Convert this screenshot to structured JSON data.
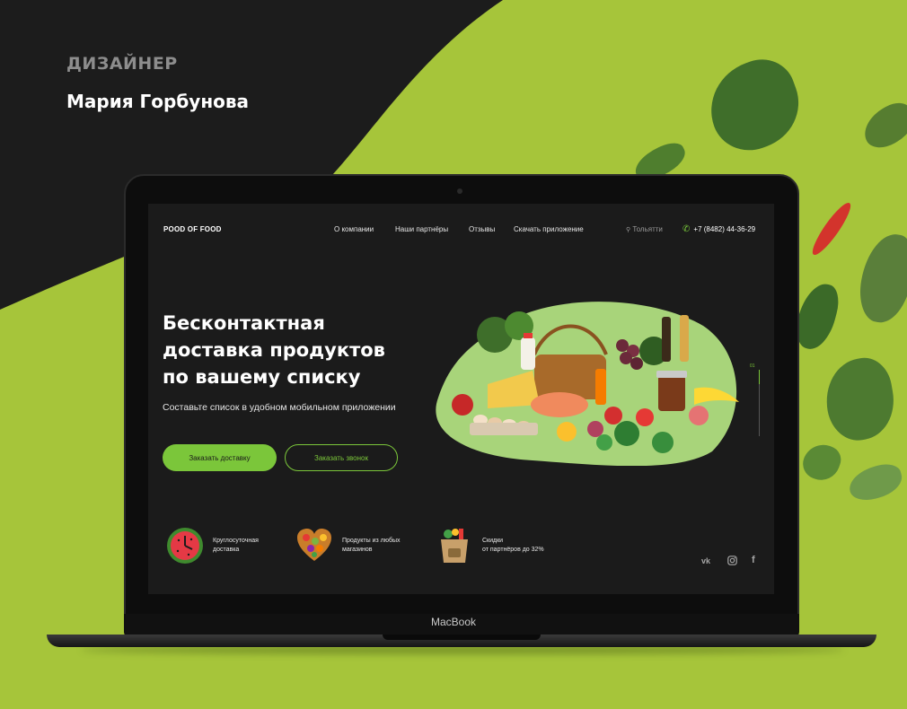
{
  "designer": {
    "label": "ДИЗАЙНЕР",
    "name": "Мария Горбунова"
  },
  "laptop_brand": "MacBook",
  "site": {
    "logo": "POOD OF FOOD",
    "nav": [
      "О компании",
      "Наши партнёры",
      "Отзывы",
      "Скачать приложение"
    ],
    "city": "Тольятти",
    "phone": "+7 (8482) 44-36-29",
    "hero_lines": [
      "Бесконтактная",
      "доставка продуктов",
      "по вашему списку"
    ],
    "subtitle": "Составьте список в удобном мобильном приложении",
    "primary_button": "Заказать доставку",
    "secondary_button": "Заказать звонок",
    "slider_number": "01",
    "features": [
      {
        "icon": "watermelon-clock-icon",
        "line1": "Круглосуточная",
        "line2": "доставка"
      },
      {
        "icon": "fruit-heart-icon",
        "line1": "Продукты из любых",
        "line2": "магазинов"
      },
      {
        "icon": "grocery-bag-icon",
        "line1": "Скидки",
        "line2": "от партнёров до 32%"
      }
    ],
    "social": [
      "vk-icon",
      "instagram-icon",
      "facebook-icon"
    ]
  },
  "colors": {
    "accent": "#7bc63a",
    "background_green": "#a6c53a",
    "dark": "#1b1b1b"
  }
}
